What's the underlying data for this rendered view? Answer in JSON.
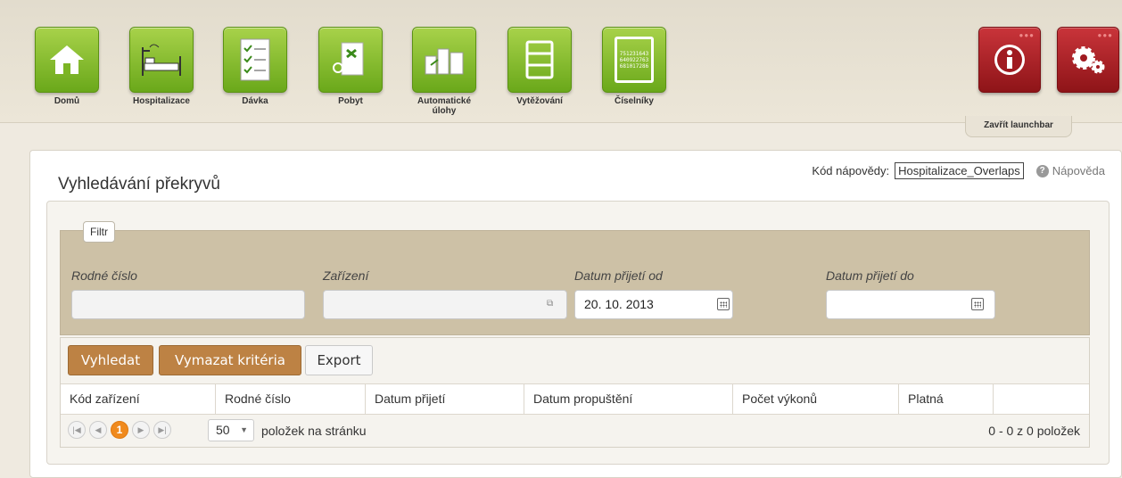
{
  "launchbar": {
    "items": [
      {
        "label": "Domů",
        "icon": "home-icon"
      },
      {
        "label": "Hospitalizace",
        "icon": "bed-icon"
      },
      {
        "label": "Dávka",
        "icon": "checklist-icon"
      },
      {
        "label": "Pobyt",
        "icon": "document-cut-icon"
      },
      {
        "label": "Automatické\núlohy",
        "icon": "blocks-icon"
      },
      {
        "label": "Vytěžování",
        "icon": "cabinet-icon"
      },
      {
        "label": "Číselníky",
        "icon": "numbers-icon"
      }
    ],
    "numbers_tile_text": [
      "751231643",
      "640922763",
      "681017286"
    ],
    "close_label": "Zavřít launchbar"
  },
  "page": {
    "title": "Vyhledávání překryvů",
    "help_code_label": "Kód nápovědy:",
    "help_code_value": "Hospitalizace_Overlaps",
    "help_link": "Nápověda"
  },
  "filter": {
    "tab": "Filtr",
    "fields": {
      "rodne_cislo": {
        "label": "Rodné číslo",
        "value": ""
      },
      "zarizeni": {
        "label": "Zařízení",
        "value": ""
      },
      "datum_od": {
        "label": "Datum přijetí od",
        "value": "20. 10. 2013"
      },
      "datum_do": {
        "label": "Datum přijetí do",
        "value": ""
      }
    }
  },
  "toolbar": {
    "search": "Vyhledat",
    "clear": "Vymazat kritéria",
    "export": "Export"
  },
  "table": {
    "columns": [
      "Kód zařízení",
      "Rodné číslo",
      "Datum přijetí",
      "Datum propuštění",
      "Počet výkonů",
      "Platná"
    ]
  },
  "pager": {
    "current_page": "1",
    "page_size": "50",
    "per_page_label": "položek na stránku",
    "info": "0 - 0 z 0 položek"
  },
  "colors": {
    "tile_green": "#8cc43a",
    "tile_red": "#b0222a",
    "button_orange": "#bd8244",
    "filter_bg": "#cdc1a6"
  }
}
